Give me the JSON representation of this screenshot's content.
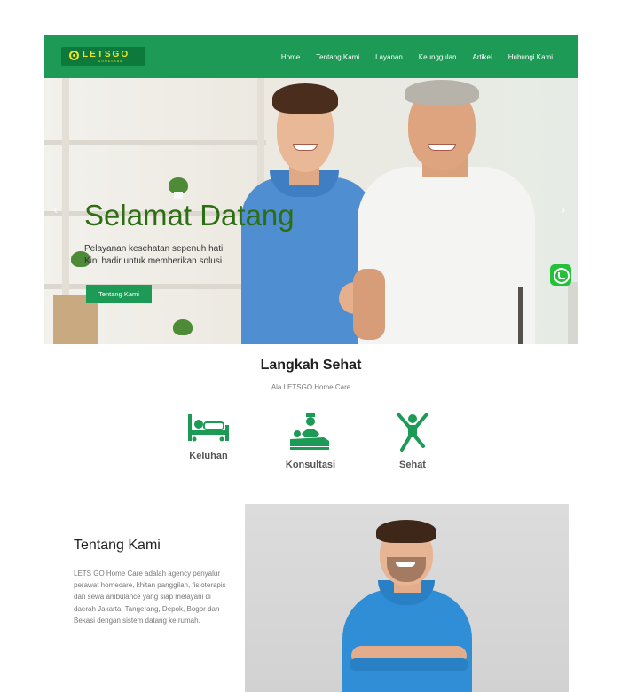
{
  "brand": {
    "name": "LETSGO",
    "tagline": "HOMECARE"
  },
  "nav": {
    "items": [
      {
        "label": "Home"
      },
      {
        "label": "Tentang Kami"
      },
      {
        "label": "Layanan"
      },
      {
        "label": "Keunggulan"
      },
      {
        "label": "Artikel"
      },
      {
        "label": "Hubungi Kami"
      }
    ]
  },
  "hero": {
    "title": "Selamat Datang",
    "subtitle_line1": "Pelayanan kesehatan sepenuh hati",
    "subtitle_line2": "Kini hadir untuk memberikan solusi",
    "button_label": "Tentang Kami",
    "prev_arrow": "‹",
    "next_arrow": "›"
  },
  "steps": {
    "title": "Langkah Sehat",
    "subtitle": "Ala LETSGO Home Care",
    "items": [
      {
        "label": "Keluhan",
        "icon": "patient-bed-icon"
      },
      {
        "label": "Konsultasi",
        "icon": "doctor-consultation-icon"
      },
      {
        "label": "Sehat",
        "icon": "healthy-person-icon"
      }
    ]
  },
  "about": {
    "title": "Tentang Kami",
    "text": "LETS GO Home Care adalah agency penyalur perawat homecare, khitan panggilan, fisioterapis dan sewa ambulance yang siap melayani di daerah Jakarta, Tangerang, Depok, Bogor dan Bekasi dengan sistem datang ke rumah."
  },
  "colors": {
    "brand_green": "#1c9a56",
    "logo_yellow": "#f5e321",
    "hero_title_green": "#2d6e12",
    "whatsapp_green": "#25c03a"
  },
  "floating": {
    "icon": "whatsapp-icon"
  }
}
